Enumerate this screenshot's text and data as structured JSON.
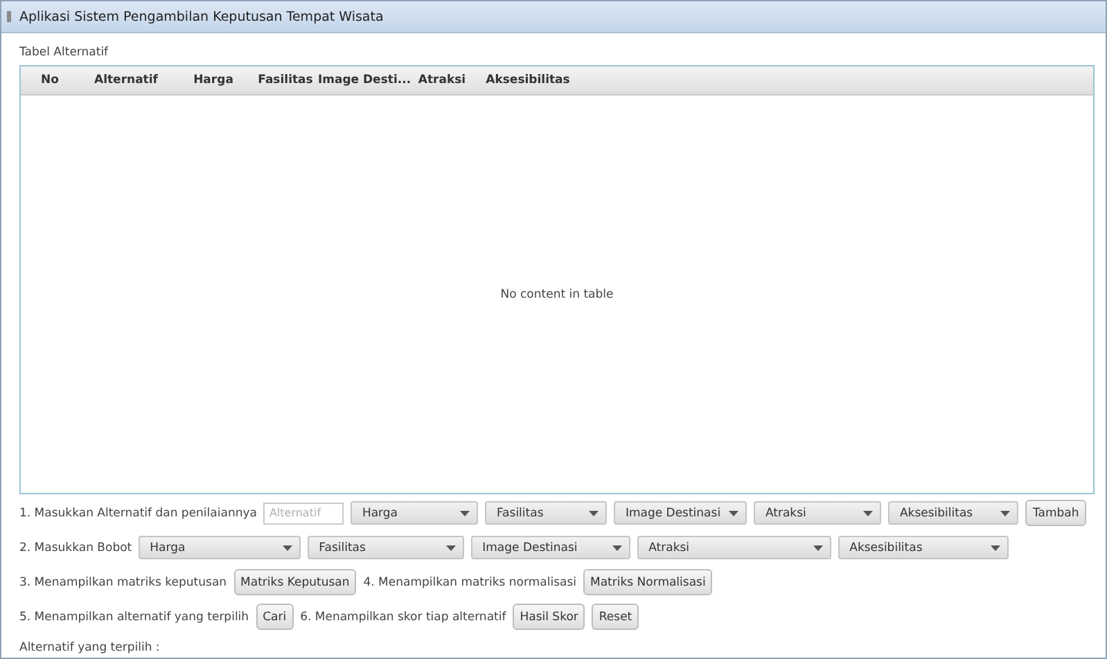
{
  "window": {
    "title": "Aplikasi Sistem Pengambilan Keputusan Tempat Wisata"
  },
  "table_label": "Tabel Alternatif",
  "table": {
    "columns": [
      "No",
      "Alternatif",
      "Harga",
      "Fasilitas",
      "Image Desti...",
      "Atraksi",
      "Aksesibilitas"
    ],
    "empty_text": "No content in table"
  },
  "rows": [
    {
      "items": [
        {
          "kind": "label",
          "text": "1. Masukkan Alternatif dan penilaiannya"
        },
        {
          "kind": "input",
          "placeholder": "Alternatif"
        },
        {
          "kind": "combo",
          "text": "Harga"
        },
        {
          "kind": "combo",
          "text": "Fasilitas"
        },
        {
          "kind": "combo",
          "text": "Image Destinasi"
        },
        {
          "kind": "combo",
          "text": "Atraksi"
        },
        {
          "kind": "combo",
          "text": "Aksesibilitas"
        },
        {
          "kind": "button",
          "text": "Tambah"
        }
      ]
    },
    {
      "items": [
        {
          "kind": "label",
          "text": "2. Masukkan Bobot"
        },
        {
          "kind": "combo",
          "text": "Harga"
        },
        {
          "kind": "combo",
          "text": "Fasilitas"
        },
        {
          "kind": "combo",
          "text": "Image Destinasi"
        },
        {
          "kind": "combo",
          "text": "Atraksi"
        },
        {
          "kind": "combo",
          "text": "Aksesibilitas"
        }
      ]
    },
    {
      "items": [
        {
          "kind": "label",
          "text": "3. Menampilkan matriks keputusan"
        },
        {
          "kind": "button",
          "text": "Matriks Keputusan"
        },
        {
          "kind": "label",
          "text": "4. Menampilkan matriks normalisasi"
        },
        {
          "kind": "button",
          "text": "Matriks Normalisasi"
        }
      ]
    },
    {
      "items": [
        {
          "kind": "label",
          "text": "5. Menampilkan alternatif yang terpilih"
        },
        {
          "kind": "button",
          "text": "Cari"
        },
        {
          "kind": "label",
          "text": "6. Menampilkan skor tiap alternatif"
        },
        {
          "kind": "button",
          "text": "Hasil Skor"
        },
        {
          "kind": "button",
          "text": "Reset"
        }
      ]
    }
  ],
  "result_label": "Alternatif yang terpilih :"
}
